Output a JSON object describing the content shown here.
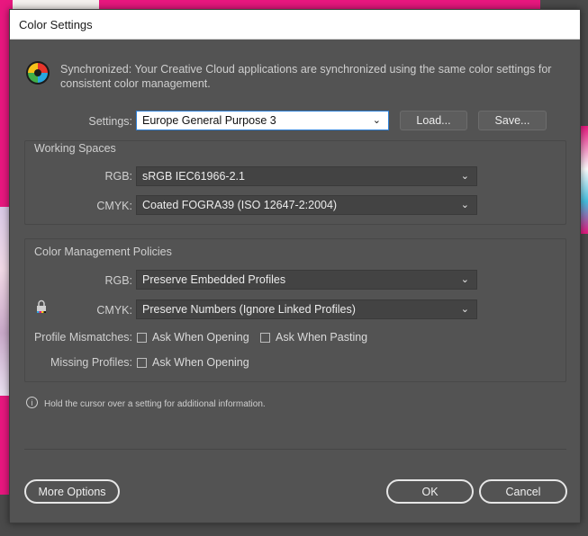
{
  "window": {
    "title": "Color Settings"
  },
  "sync": {
    "message": "Synchronized: Your Creative Cloud applications are synchronized using the same color settings for consistent color management.",
    "icon": "color-wheel-icon"
  },
  "settings": {
    "label": "Settings:",
    "value": "Europe General Purpose 3",
    "load_label": "Load...",
    "save_label": "Save..."
  },
  "working_spaces": {
    "title": "Working Spaces",
    "rgb_label": "RGB:",
    "rgb_value": "sRGB IEC61966-2.1",
    "cmyk_label": "CMYK:",
    "cmyk_value": "Coated FOGRA39 (ISO 12647-2:2004)"
  },
  "policies": {
    "title": "Color Management Policies",
    "rgb_label": "RGB:",
    "rgb_value": "Preserve Embedded Profiles",
    "cmyk_label": "CMYK:",
    "cmyk_value": "Preserve Numbers (Ignore Linked Profiles)",
    "mismatch_label": "Profile Mismatches:",
    "mismatch_opening": "Ask When Opening",
    "mismatch_pasting": "Ask When Pasting",
    "missing_label": "Missing Profiles:",
    "missing_opening": "Ask When Opening"
  },
  "info": {
    "text": "Hold the cursor over a setting for additional information."
  },
  "footer": {
    "more_options": "More Options",
    "ok": "OK",
    "cancel": "Cancel"
  },
  "colors": {
    "dialog_bg": "#535353",
    "field_bg": "#434343",
    "focus": "#2c7fd6"
  }
}
